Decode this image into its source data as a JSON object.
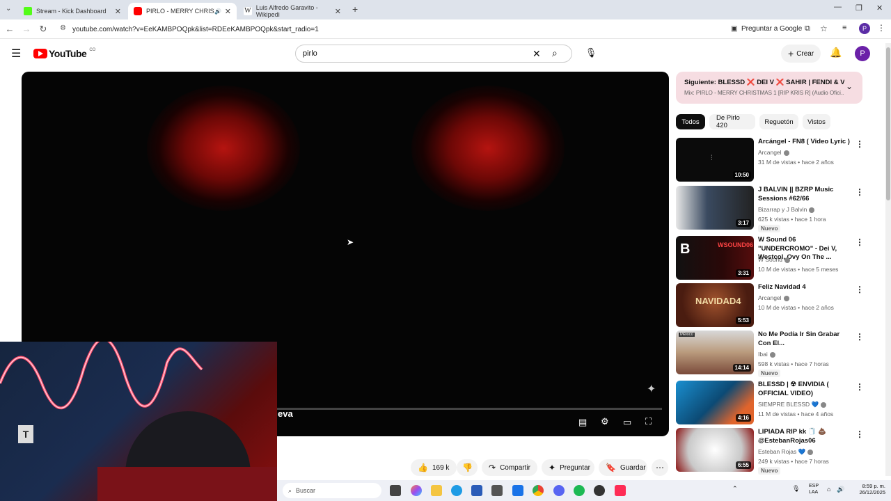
{
  "browser": {
    "tabs": [
      {
        "title": "Stream - Kick Dashboard",
        "active": false,
        "favicon_color": "#53fc18"
      },
      {
        "title": "PIRLO - MERRY CHRISTMAS",
        "active": true,
        "favicon_color": "#ff0000"
      },
      {
        "title": "Luis Alfredo Garavito - Wikipedi",
        "active": false,
        "favicon_color": "#222222"
      }
    ],
    "url": "youtube.com/watch?v=EeKAMBPOQpk&list=RDEeKAMBPOQpk&start_radio=1",
    "ask_google": "Preguntar a Google",
    "profile_initial": "P"
  },
  "youtube": {
    "logo_text": "YouTube",
    "country": "CO",
    "search_value": "pirlo",
    "create_label": "Crear",
    "avatar_initial": "P"
  },
  "player": {
    "overlay_text": "eva"
  },
  "up_next": {
    "title": "Siguiente: BLESSD ❌ DEI V ❌ SAHIR | FENDI & V...",
    "subtitle": "Mix: PIRLO - MERRY CHRISTMAS 1 [RIP KRIS R] (Audio Ofici..."
  },
  "chips": [
    "Todos",
    "De Pirlo 420",
    "Reguetón",
    "Vistos"
  ],
  "recommendations": [
    {
      "title": "Arcángel - FN8 ( Video Lyric )",
      "channel": "Arcangel",
      "meta": "31 M de vistas • hace 2 años",
      "duration": "10:50",
      "badge": "",
      "thumb_color": "#0b0b0b"
    },
    {
      "title": "J BALVIN || BZRP Music Sessions #62/66",
      "channel": "Bizarrap  y J Balvin",
      "meta": "625 k vistas • hace 1 hora",
      "duration": "3:17",
      "badge": "Nuevo",
      "thumb_color": "#2b3a52"
    },
    {
      "title": "W Sound 06 \"UNDERCROMO\" - Dei V, Westcol, Ovy On The ...",
      "channel": "W Sound",
      "meta": "10 M de vistas • hace 5 meses",
      "duration": "3:31",
      "badge": "",
      "thumb_color": "#3a0e0e"
    },
    {
      "title": "Feliz Navidad 4",
      "channel": "Arcangel",
      "meta": "10 M de vistas • hace 2 años",
      "duration": "5:53",
      "badge": "",
      "thumb_color": "#5a2818"
    },
    {
      "title": "No Me Podía Ir Sin Grabar Con El...",
      "channel": "Ibai",
      "meta": "598 k vistas • hace 7 horas",
      "duration": "14:14",
      "badge": "Nuevo",
      "thumb_color": "#7d6a55"
    },
    {
      "title": "BLESSD | ☢ ENVIDIA ( OFFICIAL VIDEO)",
      "channel": "SIEMPRE BLESSD 💙",
      "meta": "11 M de vistas • hace 4 años",
      "duration": "4:16",
      "badge": "",
      "thumb_color": "#1d5f8a"
    },
    {
      "title": "LIPIADA RIP kk 🧻 💩 @EstebanRojas06",
      "channel": "Esteban Rojas 💙",
      "meta": "249 k vistas • hace 7 horas",
      "duration": "6:55",
      "badge": "Nuevo",
      "thumb_color": "#c9c9c9"
    }
  ],
  "actions": {
    "likes": "169 k",
    "share": "Compartir",
    "ask": "Preguntar",
    "save": "Guardar"
  },
  "taskbar": {
    "search_placeholder": "Buscar",
    "lang": "ESP",
    "lang2": "LAA",
    "time": "8:59 p. m.",
    "date": "26/12/2025"
  }
}
